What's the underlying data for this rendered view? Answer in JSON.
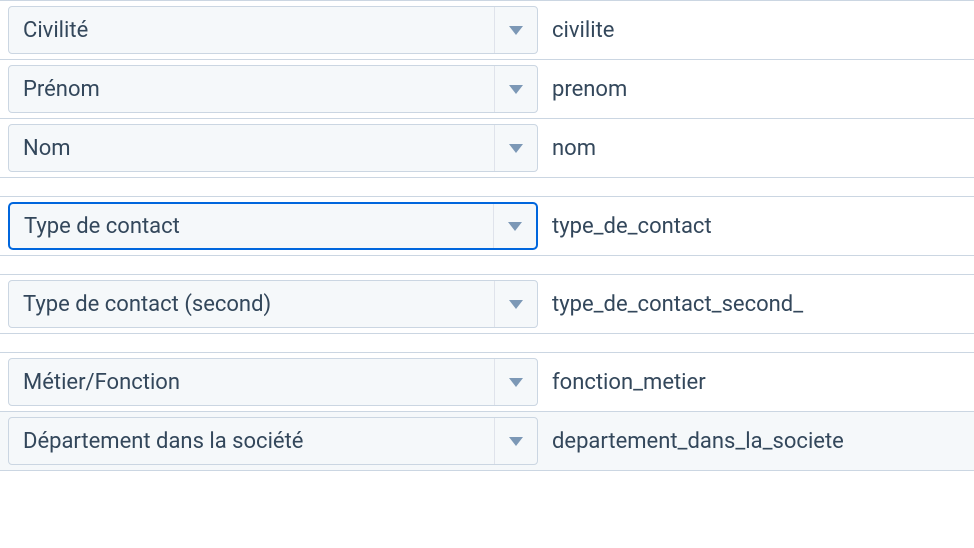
{
  "rows": [
    {
      "label": "Civilité",
      "key": "civilite",
      "group_start": true,
      "focused": false,
      "highlight": false
    },
    {
      "label": "Prénom",
      "key": "prenom",
      "group_start": false,
      "focused": false,
      "highlight": false
    },
    {
      "label": "Nom",
      "key": "nom",
      "group_start": false,
      "focused": false,
      "highlight": false
    },
    {
      "label": "Type de contact",
      "key": "type_de_contact",
      "group_start": true,
      "focused": true,
      "highlight": false
    },
    {
      "label": "Type de contact (second)",
      "key": "type_de_contact_second_",
      "group_start": true,
      "focused": false,
      "highlight": false
    },
    {
      "label": "Métier/Fonction",
      "key": "fonction_metier",
      "group_start": true,
      "focused": false,
      "highlight": false
    },
    {
      "label": "Département dans la société",
      "key": "departement_dans_la_societe",
      "group_start": false,
      "focused": false,
      "highlight": true
    }
  ]
}
